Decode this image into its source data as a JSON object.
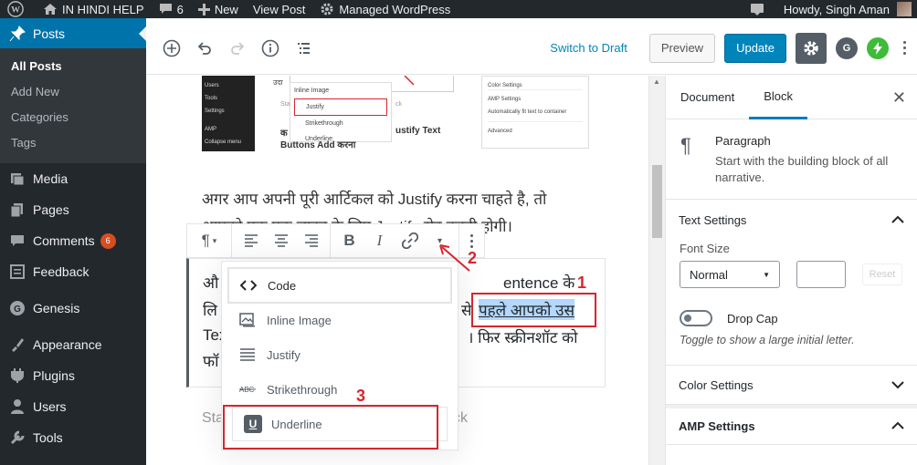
{
  "adminbar": {
    "site_name": "IN HINDI HELP",
    "comments_count": "6",
    "new_label": "New",
    "view_post": "View Post",
    "managed": "Managed WordPress",
    "howdy": "Howdy, Singh Aman"
  },
  "sidebar": {
    "posts": "Posts",
    "submenu": [
      "All Posts",
      "Add New",
      "Categories",
      "Tags"
    ],
    "items": [
      {
        "label": "Media",
        "icon": "media-icon"
      },
      {
        "label": "Pages",
        "icon": "pages-icon"
      },
      {
        "label": "Comments",
        "icon": "comments-icon",
        "badge": "6"
      },
      {
        "label": "Feedback",
        "icon": "feedback-icon"
      },
      {
        "label": "Genesis",
        "icon": "genesis-icon"
      },
      {
        "label": "Appearance",
        "icon": "appearance-icon"
      },
      {
        "label": "Plugins",
        "icon": "plugins-icon"
      },
      {
        "label": "Users",
        "icon": "users-icon"
      },
      {
        "label": "Tools",
        "icon": "tools-icon"
      }
    ]
  },
  "toolbar": {
    "switch_draft": "Switch to Draft",
    "preview": "Preview",
    "update": "Update"
  },
  "content": {
    "image": {
      "dark_menu": [
        "Users",
        "Tools",
        "Settings",
        "AMP",
        "Collapse menu"
      ],
      "mid_heading": "उदा",
      "dropdown_items": [
        "Inline Image",
        "Justify",
        "Strikethrough",
        "Underline"
      ],
      "mid_caption_start": "Sta",
      "mid_caption_end": "ck",
      "mid_text": "क",
      "mid_text2": "ustify Text",
      "mid_text3": "Buttons Add करना",
      "right_item1": "Color Settings",
      "right_item2": "AMP Settings",
      "right_item3": "Automatically fit text to container",
      "right_item4": "Advanced"
    },
    "para1_line1": "अगर आप अपनी पूरी आर्टिकल को Justify करना चाहते है, तो",
    "para1_line2": "आपको एक एक लाइन के लिए Justify सेट करनी होगी।",
    "para2": {
      "l1_start": "औ",
      "l1_mid": "entence के",
      "l2_start": "लि",
      "l2_mid": "से",
      "l2_highlight": "पहले आपको उस",
      "l3_start": "Tex",
      "l3_end": "। फिर स्क्रीनशॉट को",
      "l4_start": "फॉ"
    },
    "caption_start": "Sta",
    "caption_end": "ck"
  },
  "dropdown": {
    "items": [
      {
        "label": "Code",
        "icon": "code-icon"
      },
      {
        "label": "Inline Image",
        "icon": "image-icon"
      },
      {
        "label": "Justify",
        "icon": "justify-icon"
      },
      {
        "label": "Strikethrough",
        "icon": "strikethrough-icon"
      },
      {
        "label": "Underline",
        "icon": "underline-icon"
      }
    ]
  },
  "annotations": {
    "n1": "1",
    "n2": "2",
    "n3": "3"
  },
  "panel": {
    "tab_document": "Document",
    "tab_block": "Block",
    "block_name": "Paragraph",
    "block_desc": "Start with the building block of all narrative.",
    "text_settings": "Text Settings",
    "font_size_label": "Font Size",
    "font_size_value": "Normal",
    "reset": "Reset",
    "drop_cap": "Drop Cap",
    "drop_cap_help": "Toggle to show a large initial letter.",
    "color_settings": "Color Settings",
    "amp_settings": "AMP Settings"
  },
  "colors": {
    "accent": "#0085ba",
    "annotation_red": "#d5262d",
    "admin_dark": "#23282d"
  }
}
